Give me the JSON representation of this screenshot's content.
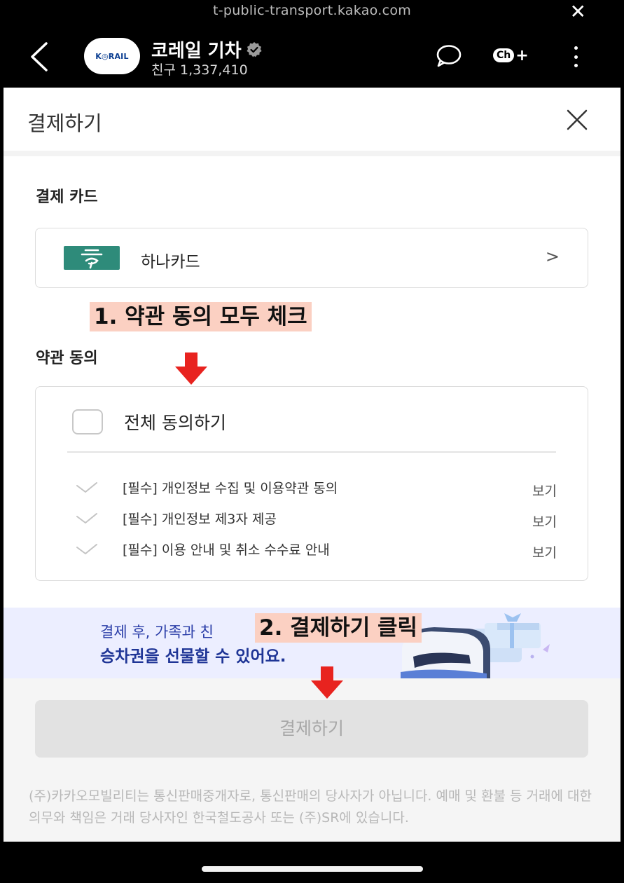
{
  "browser": {
    "url": "t-public-transport.kakao.com",
    "close_glyph": "✕"
  },
  "channel": {
    "logo_text": "K◎RAIL",
    "name": "코레일 기차",
    "friends": "친구 1,337,410",
    "chplus_label": "Ch",
    "chplus_plus": "+"
  },
  "header": {
    "title": "결제하기"
  },
  "payment_card": {
    "section_title": "결제 카드",
    "card_name": "하나카드",
    "arrow": ">"
  },
  "terms": {
    "section_title": "약관 동의",
    "all_agree": "전체 동의하기",
    "items": [
      {
        "label": "[필수] 개인정보 수집 및 이용약관 동의",
        "view": "보기"
      },
      {
        "label": "[필수] 개인정보 제3자 제공",
        "view": "보기"
      },
      {
        "label": "[필수] 이용 안내 및 취소 수수료 안내",
        "view": "보기"
      }
    ]
  },
  "banner": {
    "line1": "결제 후, 가족과 친",
    "line2": "승차권을 선물할 수 있어요."
  },
  "pay_button": "결제하기",
  "notice": "(주)카카오모빌리티는 통신판매중개자로, 통신판매의 당사자가 아닙니다. 예매 및 환불 등 거래에 대한 의무와 책임은 거래 당사자인 한국철도공사 또는 (주)SR에 있습니다.",
  "annotations": {
    "step1": "1. 약관 동의 모두 체크",
    "step2": "2. 결제하기 클릭"
  },
  "colors": {
    "hana_green": "#2e8b7a",
    "annotation_bg": "#fbd0c2",
    "arrow_red": "#e8231f",
    "banner_bg": "#eceeff",
    "banner_text": "#1f3596"
  }
}
